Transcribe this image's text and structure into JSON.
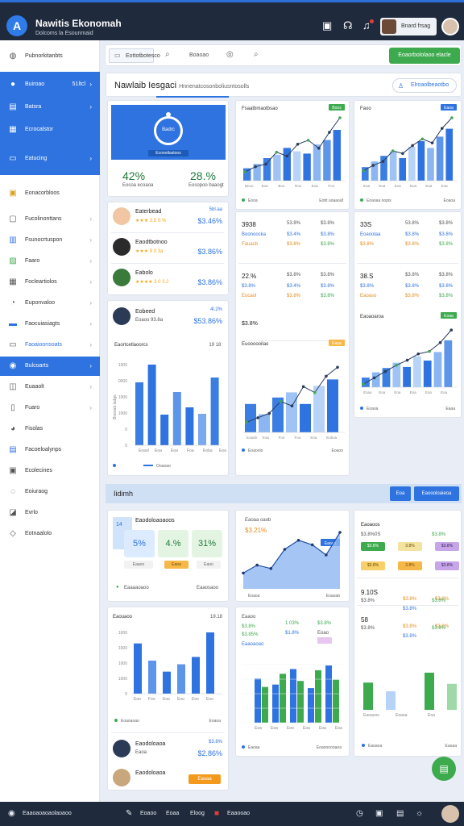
{
  "app": {
    "title": "Nawitis Ekonomah",
    "subtitle": "Dolcoms la Esounmaid",
    "user_name": "Bnard frsag"
  },
  "sidebar": {
    "top_label": "Pubnorkitanbts",
    "block_items": [
      {
        "label": "Buiroao",
        "count": "51ltcl",
        "icon": "circle-icon"
      },
      {
        "label": "Batsra",
        "icon": "table-icon"
      },
      {
        "label": "Ecrocalstor",
        "icon": "grid-icon"
      },
      {
        "label": "Eatucing",
        "icon": "card-icon"
      }
    ],
    "section_label": "Eonacorbloos",
    "items": [
      {
        "label": "Fucolinonttans",
        "icon": "folder-icon"
      },
      {
        "label": "Fsunocrtuspon",
        "icon": "chart-icon"
      },
      {
        "label": "Faaro",
        "icon": "image-icon"
      },
      {
        "label": "Focleartiolos",
        "icon": "calendar-icon"
      },
      {
        "label": "Euponvaloo",
        "icon": "bell-icon"
      },
      {
        "label": "Faocuiasiagts",
        "icon": "link-icon"
      },
      {
        "label": "Faoaioonsoats",
        "icon": "mail-icon"
      },
      {
        "label": "Bulcoarts",
        "icon": "globe-icon"
      },
      {
        "label": "Euaaolt",
        "icon": "tag-icon"
      },
      {
        "label": "Fuaro",
        "icon": "doc-icon"
      },
      {
        "label": "Fisolas",
        "icon": "dot-icon"
      },
      {
        "label": "Facoeloalynps",
        "icon": "page-icon"
      },
      {
        "label": "Ecolecines",
        "icon": "calc-icon"
      },
      {
        "label": "Eoiuraog",
        "icon": "pin-icon"
      },
      {
        "label": "Evrlo",
        "icon": "clip-icon"
      },
      {
        "label": "Eotnaalolo",
        "icon": "link2-icon"
      }
    ]
  },
  "toolbar": {
    "tab": "Eottotbotesco",
    "label2": "Boaoao",
    "button": "Eoaorbololaoo elacle"
  },
  "panel": {
    "title": "Nawlaib Iesgaci",
    "subtitle": "Hnnenatcosonboliusntosolls",
    "button": "Elroaolbeaotbo"
  },
  "hero": {
    "ring": "Badrc",
    "caption": "Econotlastoos",
    "left_value": "42%",
    "left_label": "Eocoa ecoaoa",
    "right_value": "28.%",
    "right_label": "Eosopoo baaogt"
  },
  "people": [
    {
      "name": "Eaterbead",
      "rating": "★★★ 3.5 0.%",
      "amount_top": "5bl.aa",
      "amount": "$3.46%"
    },
    {
      "name": "Eaodtbotnoo",
      "rating": "★★★ 9 0 3a",
      "amount_top": "",
      "amount": "$3.86%"
    },
    {
      "name": "Eabolo",
      "rating": "★★★★ 3 0 3.2",
      "amount_top": "",
      "amount": "$3.86%"
    },
    {
      "name": "Eobeed",
      "rating": "Eoaoo 93.8a",
      "amount_top": "4l.2%",
      "amount": "$53.86%"
    }
  ],
  "chart_left": {
    "title": "Eaortcetlaoorcs",
    "right": "19 18:",
    "values": [
      78,
      100,
      38,
      66,
      47,
      39,
      84
    ],
    "ylabel": "Bneoab ladge",
    "legend": "Ooaoao",
    "ticks": [
      "1000",
      "0000",
      "1000",
      "1000",
      "0",
      "0"
    ],
    "cats": [
      "Eoaol",
      "Eoa",
      "Eoa",
      "Foa",
      "Eoba",
      "Eoa"
    ]
  },
  "chart_mid": {
    "title": "Fsaatbmaotbsao",
    "badge": "Boos",
    "bars": [
      22,
      30,
      40,
      46,
      58,
      52,
      48,
      64,
      72,
      90
    ],
    "line": [
      18,
      26,
      30,
      48,
      42,
      60,
      66,
      54,
      78,
      100
    ],
    "legend": "Eooa",
    "legend_right": "Eobt uoaaoaf",
    "cats": [
      "Bnoo",
      "Eoa",
      "Boo",
      "Roo",
      "Eoa",
      "Foo"
    ]
  },
  "chart_right": {
    "title": "Faoo",
    "badge": "Eaoa",
    "bars": [
      24,
      34,
      44,
      52,
      40,
      60,
      70,
      58,
      78,
      92
    ],
    "line": [
      20,
      28,
      34,
      50,
      46,
      58,
      68,
      62,
      84,
      100
    ],
    "legend": "Eoaoaa oopis",
    "legend_right": "Eoaoa",
    "cats": [
      "Eoa",
      "Eoa",
      "Eoa",
      "Eoa",
      "Eoa",
      "Eoa"
    ]
  },
  "stats_mid": [
    {
      "a": "3938",
      "b": "53.8%",
      "c": "$3.8%",
      "d": "Boonoocka",
      "e": "$3.4%",
      "f": "$3.8%",
      "g": "Fauacb",
      "h": "$3.8%",
      "i": "$3.8%"
    },
    {
      "a": "22.%",
      "b": "$3.8%",
      "c": "$3.8%",
      "d": "$3.8%",
      "e": "$3.4%",
      "f": "$3.8%",
      "g": "Eocaol",
      "h": "$3.8%",
      "i": "$3.8%"
    }
  ],
  "stats_mid_extra": {
    "a": "$3.8%",
    "b": "$3.8%",
    "c": "$3.8%"
  },
  "stats_right": [
    {
      "a": "33S",
      "b": "53.8%",
      "c": "$3.8%",
      "d": "Eoaoolaa",
      "e": "$3.8%",
      "f": "$3.8%",
      "g": "$3.8%",
      "h": "$3.8%",
      "i": "$3.8%"
    },
    {
      "a": "38.S",
      "b": "$3.8%",
      "c": "$3.8%",
      "d": "$3.8%",
      "e": "$3.8%",
      "f": "$3.8%",
      "g": "Eaoaso",
      "h": "$3.8%",
      "i": "$3.8%"
    }
  ],
  "chart_mid_lower": {
    "title": "Euoooooilao",
    "badge": "Eaoa",
    "bars": [
      44,
      28,
      54,
      62,
      44,
      72,
      82
    ],
    "line": [
      18,
      24,
      30,
      46,
      40,
      66,
      58,
      80,
      92
    ],
    "legend": "Eoaoolo",
    "legend_right": "Eoaoo",
    "cats": [
      "Eoaob",
      "Eoa",
      "Foo",
      "Foo",
      "Eoa",
      "Eoboa"
    ]
  },
  "chart_right_lower": {
    "title": "Eaoaoaroa",
    "badge": "Eoaa",
    "bars": [
      18,
      28,
      36,
      46,
      38,
      58,
      50,
      66,
      88
    ],
    "line": [
      10,
      20,
      30,
      40,
      48,
      58,
      62,
      76,
      96
    ],
    "legend": "Eoaoa",
    "legend_right": "Eaaa",
    "cats": [
      "Eoao",
      "Eoa",
      "Eoa",
      "Eoa",
      "Eoa",
      "Eoa"
    ]
  },
  "section": {
    "title": "Iidimh",
    "btn1": "Eoa",
    "btn2": "Eaoooloaieoa"
  },
  "cards2": {
    "title": "Eaodoloaoaoos",
    "tag": "14",
    "pct": [
      "5%",
      "4.%",
      "31%"
    ],
    "chips": [
      "Eaaoo",
      "Eaoa",
      "Eaoo"
    ],
    "legend": "Eaaaaoaoo",
    "legend_right": "Eaaosaoo"
  },
  "chart_area": {
    "title": "Eaoaa oaob",
    "value": "$3.21%",
    "badge": "Eaoaa",
    "line": [
      28,
      42,
      36,
      70,
      86,
      78,
      60,
      100
    ],
    "legend": "Eoaoa",
    "legend_right": "Eoaoab"
  },
  "chart_bottom_left": {
    "title": "Eaouaoo",
    "right": "19.18",
    "values": [
      82,
      54,
      36,
      48,
      60,
      100
    ],
    "ticks": [
      "1000",
      "1000",
      "1000",
      "1000",
      "0"
    ],
    "cats": [
      "Eoo",
      "Foo",
      "Eoo",
      "Eoo",
      "Eoo",
      "Eoo"
    ],
    "legend": "Eoaoaoao",
    "legend_right": "Eoaoa"
  },
  "chart_bottom_mid": {
    "stats": [
      "Eaaoo",
      "1 03%",
      "$3.8%",
      "$1.8%",
      "$3.85%",
      "$3.8%",
      "Eaaoaoao",
      "Eoao"
    ],
    "green": [
      60,
      82,
      70,
      88,
      72
    ],
    "blue": [
      74,
      64,
      90,
      58,
      96
    ],
    "legend": "Eaoaa",
    "legend_right": "Eoaoooooaoa",
    "cats": [
      "Eoa",
      "Eoa",
      "Eoo",
      "Eoa",
      "Eoa",
      "Eoa"
    ]
  },
  "stats_bottom_right": [
    {
      "a": "Eaoaoos",
      "b": "",
      "c": "",
      "d": "$3.8%0S",
      "e": "",
      "f": "$3.8%"
    },
    {
      "a": "9.10S",
      "b": "$3.8%",
      "c": "$3.8%",
      "d": "$3.8%",
      "e": "$3.8%",
      "f": "$3.8%"
    },
    {
      "a": "58",
      "b": "$3.8%",
      "c": "$3.8%",
      "d": "$3.8%",
      "e": "$3.8%",
      "f": "$3.8%"
    }
  ],
  "chips_br": [
    "$3.8%",
    "3.8%",
    "$3.8%"
  ],
  "chart_bottom_right": {
    "values": [
      44,
      30,
      60,
      42
    ],
    "legend": "Eaoaoa",
    "legend_right": "Eaoaa",
    "cats": [
      "Eaoaoos",
      "Eoaoa",
      "Eoa"
    ]
  },
  "people_bottom": [
    {
      "name": "Eaodoloaoa",
      "sub": "Eaoa",
      "amount_top": "$3.8%",
      "amount": "$2.86%"
    },
    {
      "name": "Eaodoloaoa",
      "sub": "",
      "amount_top": "",
      "amount": "Eaoaa"
    }
  ],
  "bottom": {
    "label": "Eaaoaoaoaolaoaoo",
    "l1": "Eoaoo",
    "l2": "Eoaa",
    "l3": "Eloog",
    "l4": "Eaaooao"
  },
  "colors": {
    "primary": "#2f73e0",
    "green": "#3daa4e",
    "dark": "#1f2a3c"
  }
}
